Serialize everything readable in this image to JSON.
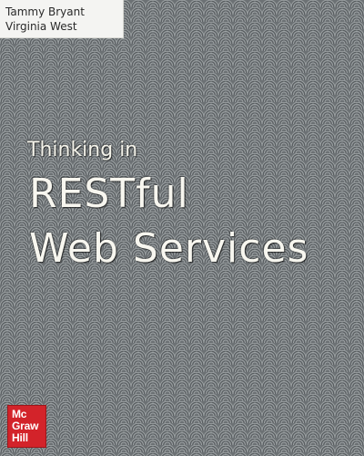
{
  "authors": [
    "Tammy Bryant",
    "Virginia West"
  ],
  "subtitle": "Thinking in",
  "title_lines": [
    "RESTful",
    "Web Services"
  ],
  "publisher_logo": {
    "lines": [
      "Mc",
      "Graw",
      "Hill"
    ],
    "color": "#d3232a"
  },
  "colors": {
    "background_pattern": "#6d7275",
    "title_text": "#f7f6ef",
    "author_box": "#f4f4f2"
  }
}
